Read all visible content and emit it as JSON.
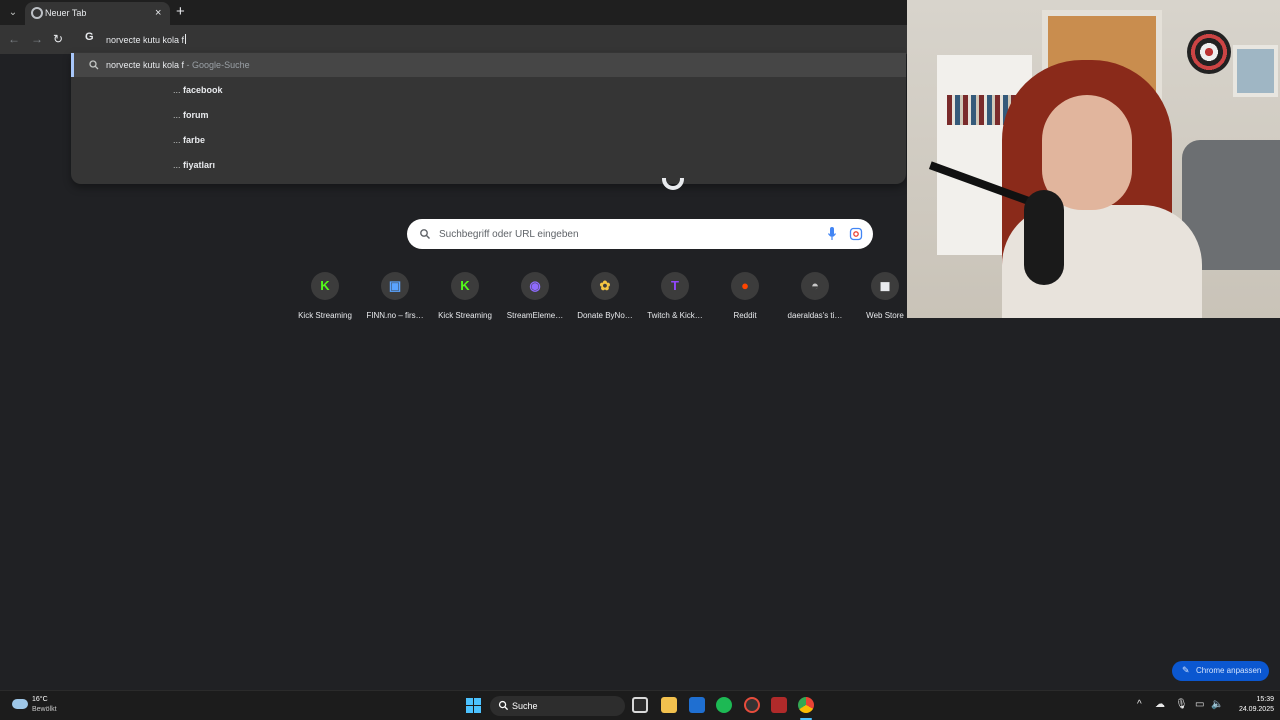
{
  "browser": {
    "tab": {
      "title": "Neuer Tab",
      "close": "×"
    },
    "new_tab": "+",
    "tab_list": "⌄"
  },
  "toolbar": {
    "back": "←",
    "forward": "→",
    "reload": "↻",
    "omnibox_engine": "G",
    "omnibox_text": "norvecte kutu kola f"
  },
  "dropdown": {
    "main": {
      "query": "norvecte kutu kola f",
      "suffix": " - Google-Suche"
    },
    "suggestions": [
      {
        "prefix": "... ",
        "text": "facebook"
      },
      {
        "prefix": "... ",
        "text": "forum"
      },
      {
        "prefix": "... ",
        "text": "farbe"
      },
      {
        "prefix": "... ",
        "text": "fiyatları"
      }
    ]
  },
  "ntp": {
    "search_placeholder": "Suchbegriff oder URL eingeben",
    "shortcuts": [
      {
        "label": "Kick Streaming",
        "glyph": "K",
        "color": "#53fc18"
      },
      {
        "label": "FINN.no – firs…",
        "glyph": "▣",
        "color": "#5aa3ff"
      },
      {
        "label": "Kick Streaming",
        "glyph": "K",
        "color": "#53fc18"
      },
      {
        "label": "StreamEleme…",
        "glyph": "◉",
        "color": "#8e6bff"
      },
      {
        "label": "Donate ByNo…",
        "glyph": "✿",
        "color": "#f4c542"
      },
      {
        "label": "Twitch & Kick…",
        "glyph": "T",
        "color": "#9146ff"
      },
      {
        "label": "Reddit",
        "glyph": "●",
        "color": "#ff4500"
      },
      {
        "label": "daeraldas's ti…",
        "glyph": "◓",
        "color": "#c8c8c8"
      },
      {
        "label": "Web Store",
        "glyph": "◼",
        "color": "#e8eaed"
      }
    ],
    "customize_label": "Chrome anpassen",
    "customize_icon": "✎"
  },
  "taskbar": {
    "weather_temp": "16°C",
    "weather_desc": "Bewölkt",
    "search_label": "Suche",
    "time": "15:39",
    "date": "24.09.2025",
    "tray_icons": [
      "^",
      "☁",
      "🎙",
      "▭",
      "🔈"
    ]
  }
}
